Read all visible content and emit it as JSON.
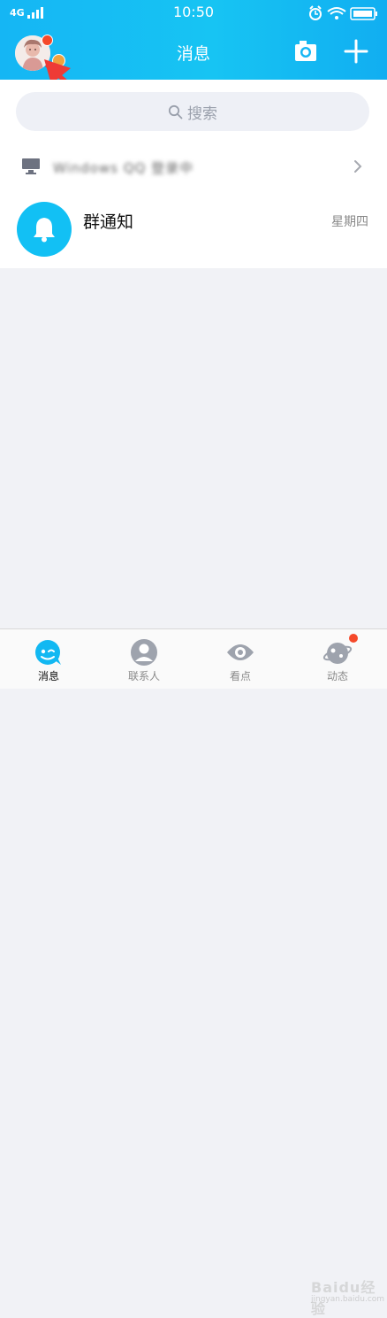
{
  "status_bar": {
    "carrier": "4G",
    "time": "10:50"
  },
  "header": {
    "title": "消息"
  },
  "search": {
    "placeholder": "搜索"
  },
  "device": {
    "name": "Windows QQ 登录中"
  },
  "messages": [
    {
      "title": "群通知",
      "time": "星期四",
      "icon": "bell-icon"
    }
  ],
  "tabs": [
    {
      "label": "消息",
      "icon": "chat-bubble-icon",
      "active": true
    },
    {
      "label": "联系人",
      "icon": "contact-person-icon"
    },
    {
      "label": "看点",
      "icon": "eye-icon"
    },
    {
      "label": "动态",
      "icon": "planet-icon",
      "badge": true
    }
  ],
  "watermark": {
    "text": "Baidu经验",
    "sub": "jingyan.baidu.com"
  },
  "colors": {
    "brand": "#12c0f4",
    "badge": "#f5492a",
    "arrow": "#ee3b36"
  }
}
